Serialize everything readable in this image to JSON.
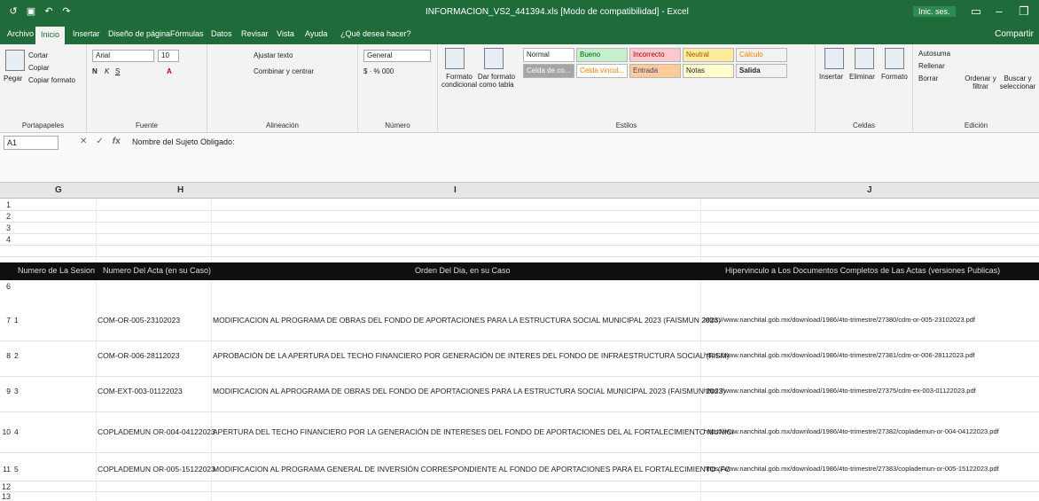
{
  "window": {
    "title": "INFORMACION_VS2_441394.xls [Modo de compatibilidad] - Excel",
    "signin": "Inic. ses."
  },
  "tabs": [
    {
      "label": "Archivo"
    },
    {
      "label": "Inicio"
    },
    {
      "label": "Insertar"
    },
    {
      "label": "Diseño de página"
    },
    {
      "label": "Fórmulas"
    },
    {
      "label": "Datos"
    },
    {
      "label": "Revisar"
    },
    {
      "label": "Vista"
    },
    {
      "label": "Ayuda"
    },
    {
      "label": "¿Qué desea hacer?"
    }
  ],
  "share_label": "Compartir",
  "ribbon": {
    "clipboard": {
      "paste": "Pegar",
      "cut": "Cortar",
      "copy": "Copiar",
      "format_painter": "Copiar formato",
      "label": "Portapapeles"
    },
    "font": {
      "name": "Arial",
      "size": "10",
      "label": "Fuente"
    },
    "alignment": {
      "wrap": "Ajustar texto",
      "merge": "Combinar y centrar",
      "label": "Alineación"
    },
    "number": {
      "format": "General",
      "label": "Número"
    },
    "styles": {
      "conditional": "Formato condicional",
      "as_table": "Dar formato como tabla",
      "cells": [
        "Normal",
        "Bueno",
        "Incorrecto",
        "Neutral",
        "Cálculo",
        "Celda de co...",
        "Celda vincul...",
        "Entrada",
        "Notas",
        "Salida"
      ],
      "label": "Estilos"
    },
    "cells": {
      "insert": "Insertar",
      "delete": "Eliminar",
      "format": "Formato",
      "label": "Celdas"
    },
    "editing": {
      "autosum": "Autosuma",
      "fill": "Rellenar",
      "clear": "Borrar",
      "sort": "Ordenar y filtrar",
      "find": "Buscar y seleccionar",
      "label": "Edición"
    }
  },
  "formula_bar": {
    "name_box": "A1",
    "content": "Nombre del Sujeto Obligado:"
  },
  "columns": [
    "G",
    "H",
    "I",
    "J"
  ],
  "row_numbers_top": [
    "1",
    "2",
    "3",
    "4"
  ],
  "table": {
    "headers": [
      "Numero de La Sesion",
      "Numero Del Acta (en su Caso)",
      "Orden Del Dia, en su Caso",
      "Hipervinculo a Los Documentos Completos de Las Actas (versiones Publicas)"
    ],
    "header_row_num": "6",
    "rows": [
      {
        "rownum": "7",
        "session": "1",
        "acta": "COM-OR-005-23102023",
        "orden": "MODIFICACION AL PROGRAMA DE OBRAS DEL FONDO DE APORTACIONES PARA LA ESTRUCTURA SOCIAL MUNICIPAL 2023 (FAISMUN 2023)",
        "link": "https://www.nanchital.gob.mx/download/1986/4to-trimestre/27380/cdm-or-005-23102023.pdf"
      },
      {
        "rownum": "8",
        "session": "2",
        "acta": "COM-OR-006-28112023",
        "orden": "APROBACIÓN DE LA APERTURA DEL TECHO FINANCIERO POR GENERACIÓN DE INTERES DEL FONDO DE INFRAESTRUCTURA SOCIAL (FISM)",
        "link": "https://www.nanchital.gob.mx/download/1986/4to-trimestre/27381/cdm-or-006-28112023.pdf"
      },
      {
        "rownum": "9",
        "session": "3",
        "acta": "COM-EXT-003-01122023",
        "orden": "MODIFICACION AL APROGRAMA DE OBRAS DEL FONDO DE APORTACIONES PARA LA ESTRUCTURA SOCIAL MUNICIPAL 2023 (FAISMUN 2023)",
        "link": "https://www.nanchital.gob.mx/download/1986/4to-trimestre/27375/cdm-ex-003-01122023.pdf"
      },
      {
        "rownum": "10",
        "session": "4",
        "acta": "COPLADEMUN OR-004-04122023",
        "orden": "APERTURA DEL TECHO FINANCIERO POR LA GENERACIÓN DE INTERESES DEL FONDO DE APORTACIONES DEL AL FORTALECIMIENTO MUNICI",
        "link": "https://www.nanchital.gob.mx/download/1986/4to-trimestre/27382/coplademun-or-004-04122023.pdf"
      },
      {
        "rownum": "11",
        "session": "5",
        "acta": "COPLADEMUN OR-005-15122023",
        "orden": "MODIFICACION AL PROGRAMA GENERAL DE INVERSIÓN CORRESPONDIENTE AL FONDO DE APORTACIONES PARA EL FORTALECIMIENTO (FC",
        "link": "https://www.nanchital.gob.mx/download/1986/4to-trimestre/27383/coplademun-or-005-15122023.pdf"
      }
    ]
  },
  "row_numbers_bottom": [
    "12",
    "13"
  ],
  "colors": {
    "excel_green": "#1f6b3a",
    "header_bar": "#0f0f0f"
  }
}
